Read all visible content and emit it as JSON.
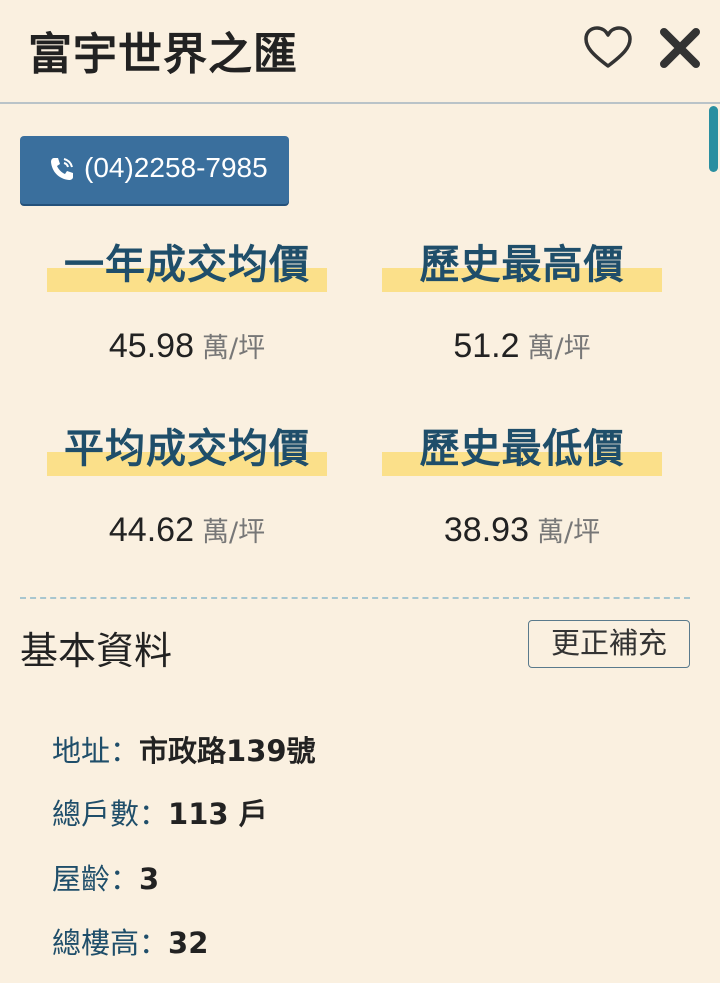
{
  "header": {
    "title": "富宇世界之匯",
    "favorite_icon": "heart-outline-icon",
    "close_icon": "close-icon"
  },
  "phone": {
    "icon": "phone-icon",
    "number": "(04)2258-7985"
  },
  "stats": [
    {
      "label": "一年成交均價",
      "value": "45.98",
      "unit": "萬/坪"
    },
    {
      "label": "歷史最高價",
      "value": "51.2",
      "unit": "萬/坪"
    },
    {
      "label": "平均成交均價",
      "value": "44.62",
      "unit": "萬/坪"
    },
    {
      "label": "歷史最低價",
      "value": "38.93",
      "unit": "萬/坪"
    }
  ],
  "basic_info": {
    "title": "基本資料",
    "edit_label": "更正補充",
    "rows": [
      {
        "key": "地址：",
        "value": "市政路139號"
      },
      {
        "key": "總戶數：",
        "value": "113 戶"
      },
      {
        "key": "屋齡：",
        "value": "3"
      },
      {
        "key": "總樓高：",
        "value": "32"
      }
    ]
  },
  "colors": {
    "background": "#faf0e0",
    "accent_blue": "#3a6f9d",
    "label_blue": "#1f4e6a",
    "highlight_yellow": "#fbe08a",
    "scrollbar": "#2a8fa0"
  }
}
